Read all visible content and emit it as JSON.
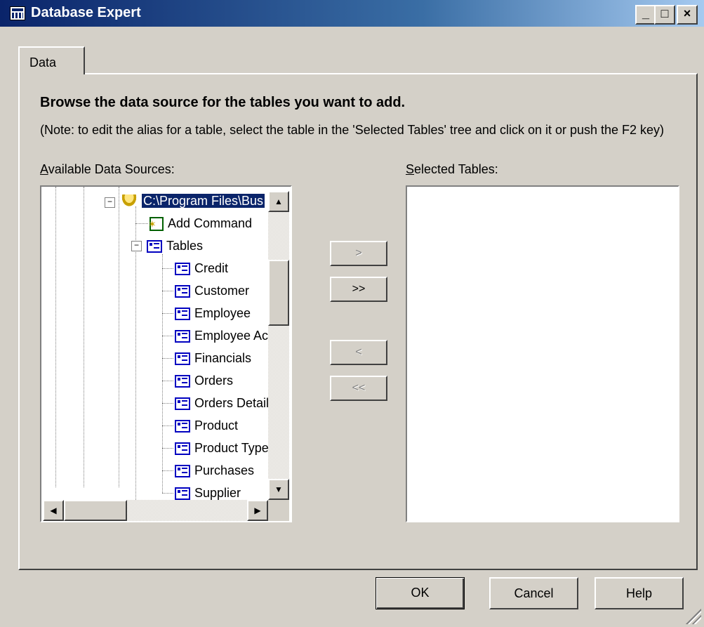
{
  "window": {
    "title": "Database Expert"
  },
  "tabs": [
    {
      "label": "Data"
    }
  ],
  "heading": "Browse the data source for the tables you want to add.",
  "note": "(Note: to edit the alias for a table, select the table in the 'Selected Tables' tree and click on it or push the F2 key)",
  "available": {
    "label_accel": "A",
    "label_rest": "vailable Data Sources:",
    "connection": "C:\\Program Files\\Bus",
    "add_command": "Add Command",
    "tables_folder": "Tables",
    "tables": [
      "Credit",
      "Customer",
      "Employee",
      "Employee Ac",
      "Financials",
      "Orders",
      "Orders Detail",
      "Product",
      "Product Type",
      "Purchases",
      "Supplier"
    ]
  },
  "selected": {
    "label_accel": "S",
    "label_rest": "elected Tables:"
  },
  "move_buttons": {
    "add_one": ">",
    "add_all": ">>",
    "remove_one": "<",
    "remove_all": "<<"
  },
  "buttons": {
    "ok": "OK",
    "cancel": "Cancel",
    "help": "Help"
  },
  "icons": {
    "connection": "database-icon",
    "command": "command-icon",
    "table": "table-icon"
  }
}
